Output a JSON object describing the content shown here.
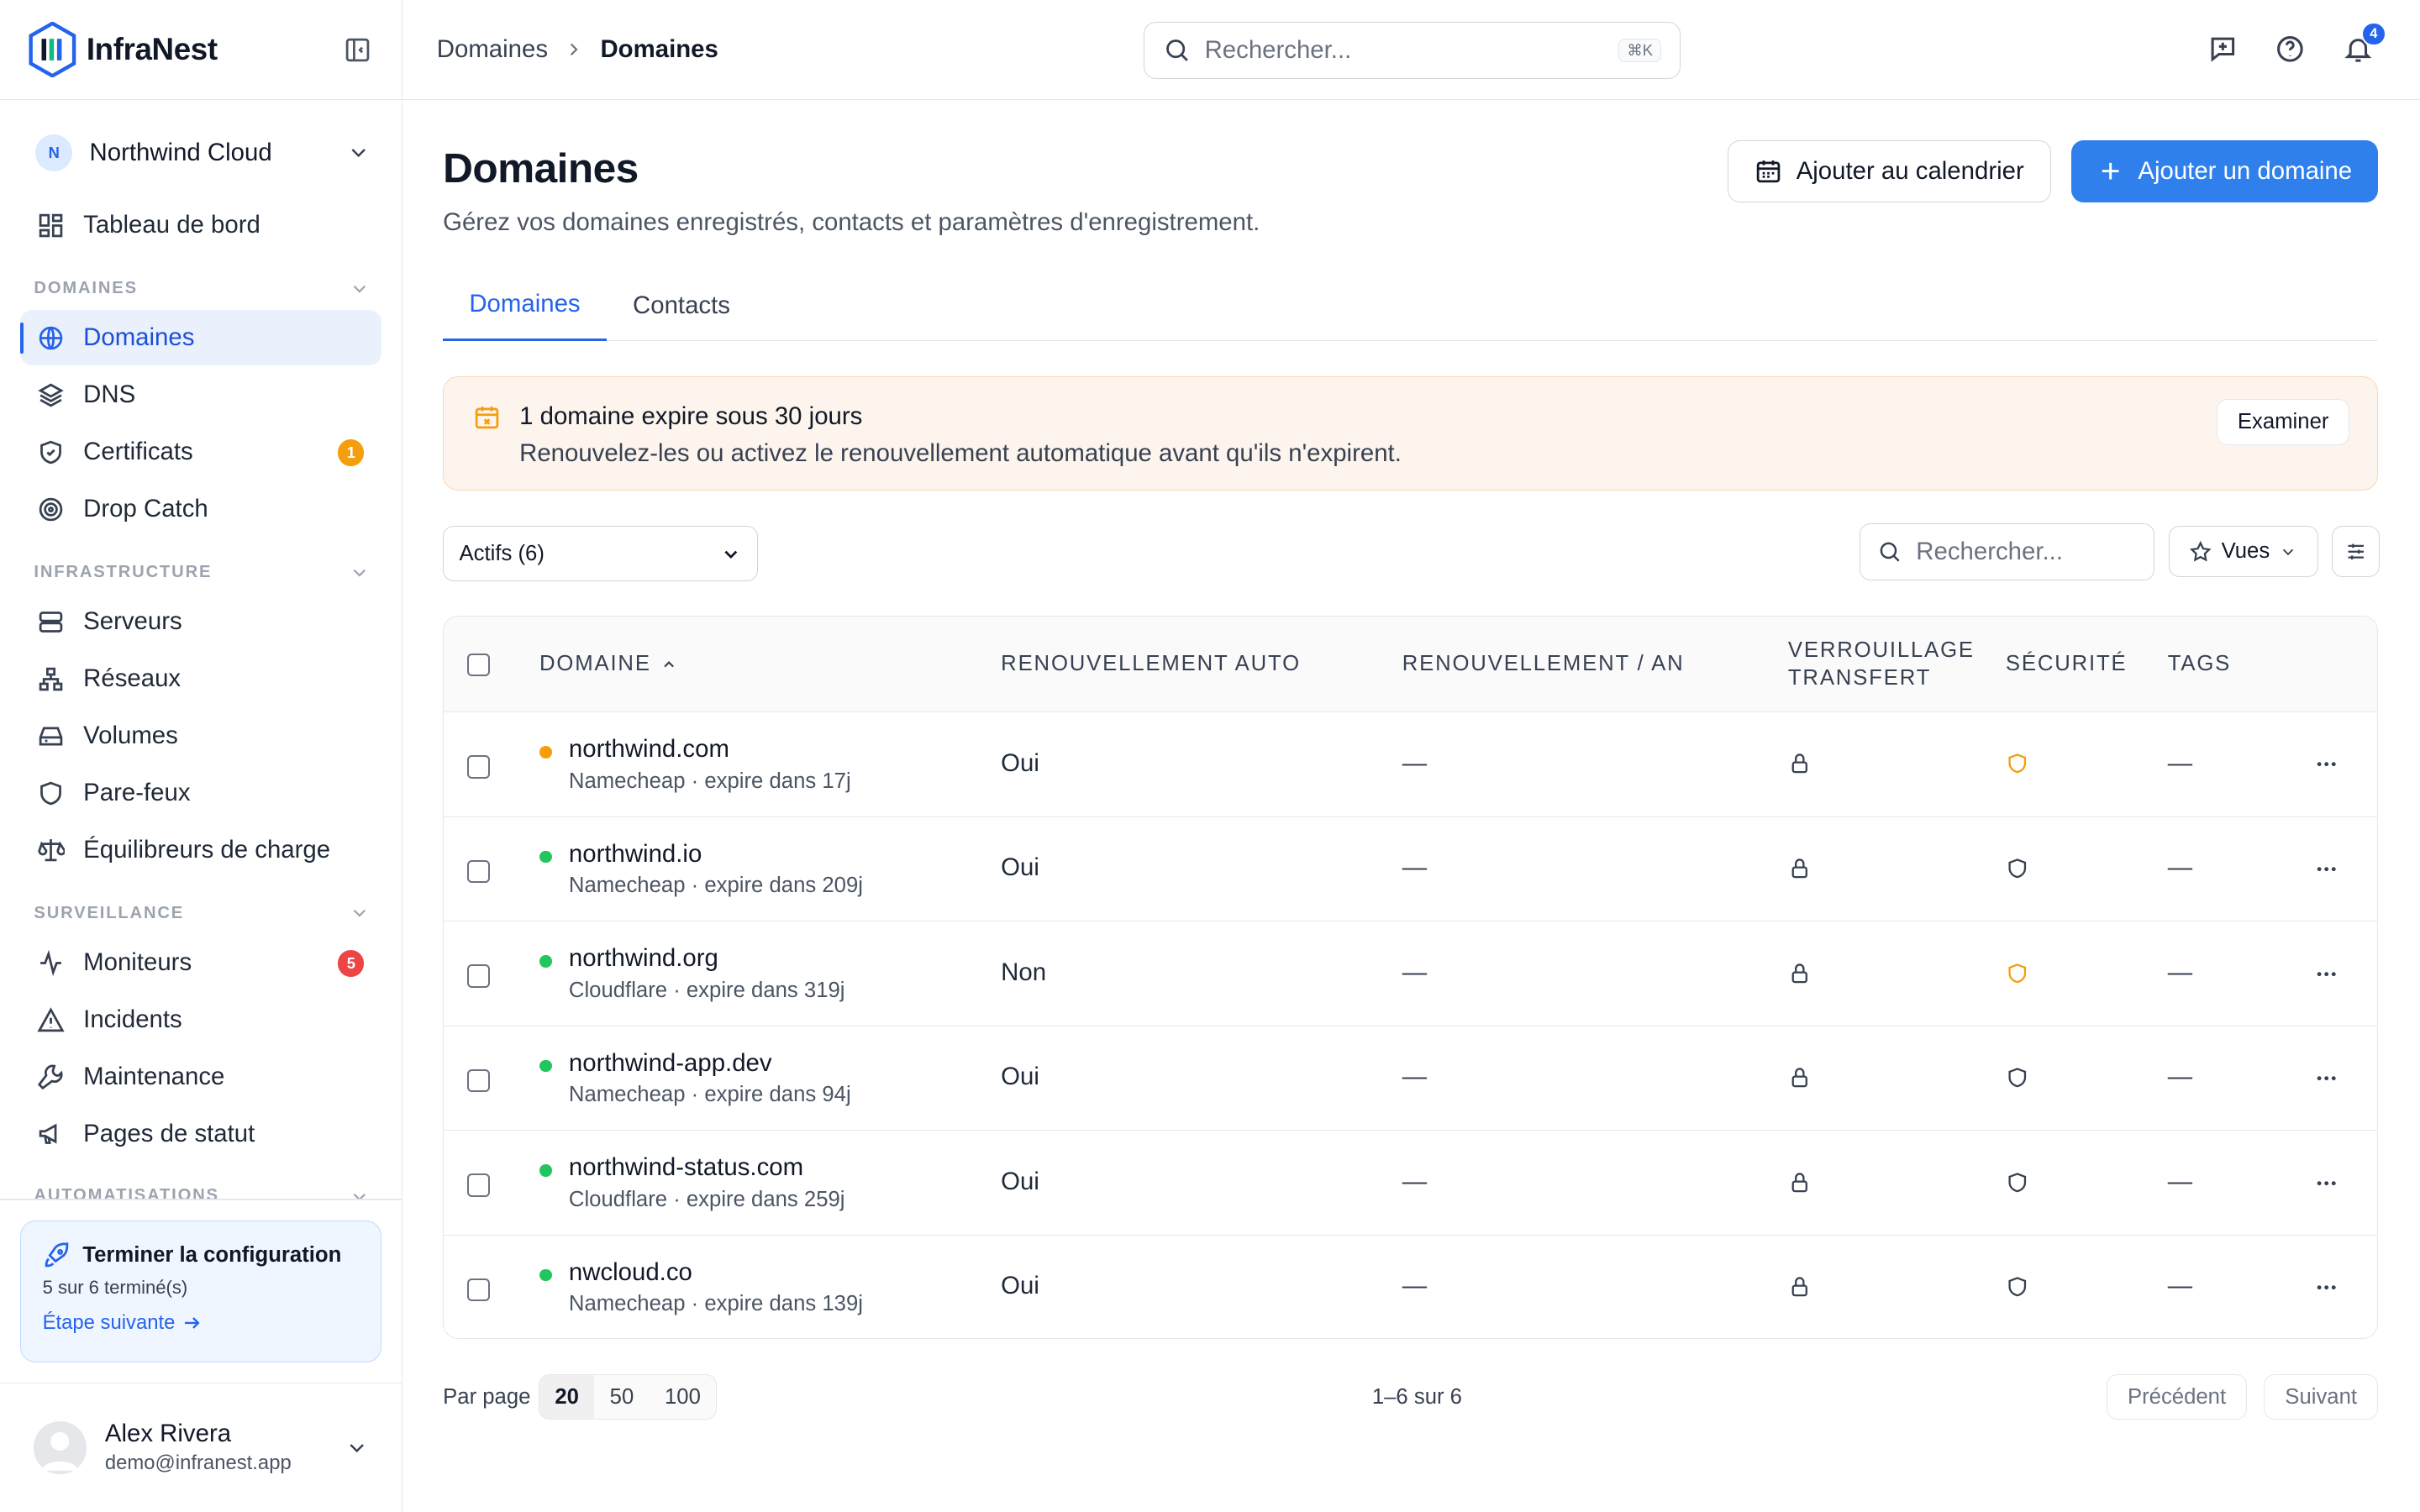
{
  "app": {
    "name": "InfraNest"
  },
  "org": {
    "name": "Northwind Cloud",
    "initial": "N"
  },
  "sidebar": {
    "top_item": "Tableau de bord",
    "sections": {
      "domaines": "DOMAINES",
      "infrastructure": "INFRASTRUCTURE",
      "surveillance": "SURVEILLANCE",
      "automatisations": "AUTOMATISATIONS"
    },
    "items": [
      {
        "label": "Domaines",
        "icon": "globe-icon"
      },
      {
        "label": "DNS",
        "icon": "layers-icon"
      },
      {
        "label": "Certificats",
        "icon": "shield-check-icon",
        "badge": "1"
      },
      {
        "label": "Drop Catch",
        "icon": "target-icon"
      },
      {
        "label": "Serveurs",
        "icon": "server-icon"
      },
      {
        "label": "Réseaux",
        "icon": "network-icon"
      },
      {
        "label": "Volumes",
        "icon": "drive-icon"
      },
      {
        "label": "Pare-feux",
        "icon": "shield-icon"
      },
      {
        "label": "Équilibreurs de charge",
        "icon": "scale-icon"
      },
      {
        "label": "Moniteurs",
        "icon": "activity-icon",
        "badge": "5"
      },
      {
        "label": "Incidents",
        "icon": "warning-icon"
      },
      {
        "label": "Maintenance",
        "icon": "wrench-icon"
      },
      {
        "label": "Pages de statut",
        "icon": "megaphone-icon"
      }
    ],
    "setup": {
      "title": "Terminer la configuration",
      "progress": "5 sur 6 terminé(s)",
      "link": "Étape suivante"
    },
    "user": {
      "name": "Alex Rivera",
      "email": "demo@infranest.app"
    }
  },
  "topbar": {
    "breadcrumb": [
      "Domaines",
      "Domaines"
    ],
    "search_placeholder": "Rechercher...",
    "shortcut": "⌘K",
    "notifications": "4"
  },
  "page": {
    "title": "Domaines",
    "subtitle": "Gérez vos domaines enregistrés, contacts et paramètres d'enregistrement.",
    "calendar_button": "Ajouter au calendrier",
    "add_button": "Ajouter un domaine",
    "tabs": [
      "Domaines",
      "Contacts"
    ]
  },
  "alert": {
    "title": "1 domaine expire sous 30 jours",
    "text": "Renouvelez-les ou activez le renouvellement automatique avant qu'ils n'expirent.",
    "button": "Examiner"
  },
  "toolbar": {
    "filter_options": [
      "Actifs (6)"
    ],
    "search_placeholder": "Rechercher...",
    "views": "Vues"
  },
  "table": {
    "headers": {
      "domain": "DOMAINE",
      "auto": "RENOUVELLEMENT AUTO",
      "price": "RENOUVELLEMENT / AN",
      "lock1": "VERROUILLAGE",
      "lock2": "TRANSFERT",
      "security": "SÉCURITÉ",
      "tags": "TAGS"
    },
    "rows": [
      {
        "domain": "northwind.com",
        "meta": "Namecheap · expire dans 17j",
        "status_color": "#f59e0b",
        "auto": "Oui",
        "price": "—",
        "security_color": "#f59e0b",
        "tags": "—"
      },
      {
        "domain": "northwind.io",
        "meta": "Namecheap · expire dans 209j",
        "status_color": "#22c55e",
        "auto": "Oui",
        "price": "—",
        "security_color": "#374151",
        "tags": "—"
      },
      {
        "domain": "northwind.org",
        "meta": "Cloudflare · expire dans 319j",
        "status_color": "#22c55e",
        "auto": "Non",
        "price": "—",
        "security_color": "#f59e0b",
        "tags": "—"
      },
      {
        "domain": "northwind-app.dev",
        "meta": "Namecheap · expire dans 94j",
        "status_color": "#22c55e",
        "auto": "Oui",
        "price": "—",
        "security_color": "#374151",
        "tags": "—"
      },
      {
        "domain": "northwind-status.com",
        "meta": "Cloudflare · expire dans 259j",
        "status_color": "#22c55e",
        "auto": "Oui",
        "price": "—",
        "security_color": "#374151",
        "tags": "—"
      },
      {
        "domain": "nwcloud.co",
        "meta": "Namecheap · expire dans 139j",
        "status_color": "#22c55e",
        "auto": "Oui",
        "price": "—",
        "security_color": "#374151",
        "tags": "—"
      }
    ]
  },
  "pager": {
    "label": "Par page",
    "sizes": [
      "20",
      "50",
      "100"
    ],
    "range": "1–6 sur 6",
    "prev": "Précédent",
    "next": "Suivant"
  },
  "colors": {
    "accent": "#2f80ed",
    "warning": "#f59e0b",
    "success": "#22c55e",
    "danger": "#ef4444"
  }
}
